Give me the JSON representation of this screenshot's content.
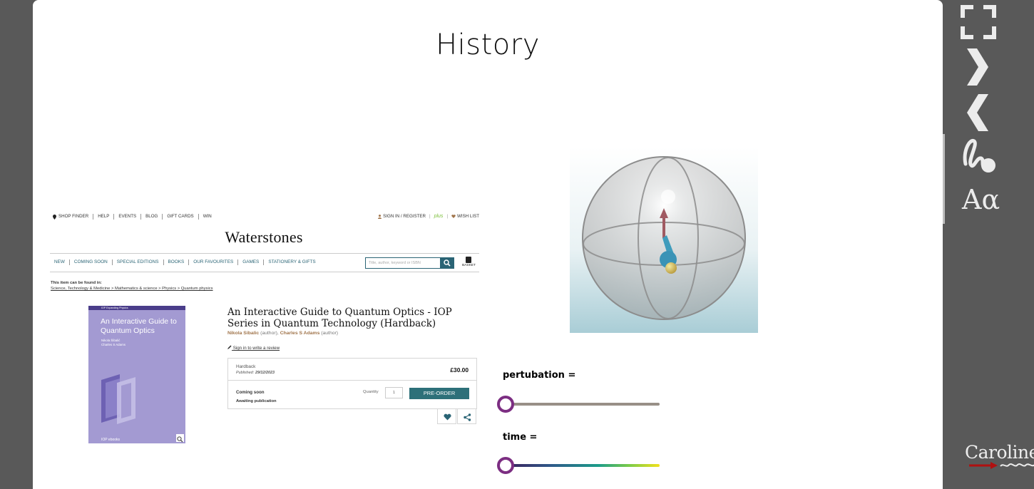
{
  "slide": {
    "title": "History"
  },
  "waterstones": {
    "top_nav": [
      "SHOP FINDER",
      "HELP",
      "EVENTS",
      "BLOG",
      "GIFT CARDS",
      "WIN"
    ],
    "sign_in": "SIGN IN / REGISTER",
    "plus": "plus",
    "wish_list": "WISH LIST",
    "logo": "Waterstones",
    "menu": [
      "NEW",
      "COMING SOON",
      "SPECIAL EDITIONS",
      "BOOKS",
      "OUR FAVOURITES",
      "GAMES",
      "STATIONERY & GIFTS"
    ],
    "search_placeholder": "Title, author, keyword or ISBN",
    "basket": "BASKET",
    "found_in_label": "This item can be found in:",
    "breadcrumb": "Science, Technology & Medicine > Mathematics & science > Physics > Quantum physics",
    "cover": {
      "series": "IOP Expanding Physics",
      "title": "An Interactive Guide to Quantum Optics",
      "authors_line1": "Nikola Šibalić",
      "authors_line2": "Charles S Adams",
      "publisher": "IOP ebooks"
    },
    "book_title": "An Interactive Guide to Quantum Optics - IOP Series in Quantum Technology (Hardback)",
    "author1": "Nikola Sibalic",
    "author2": "Charles S Adams",
    "author_role": "(author)",
    "review_link": "Sign in to write a review",
    "format": "Hardback",
    "published_label": "Published:",
    "published_date": "29/12/2023",
    "price": "£30.00",
    "status": "Coming soon",
    "availability": "Awaiting publication",
    "quantity_label": "Quantity",
    "quantity_value": "1",
    "preorder": "PRE-ORDER"
  },
  "sliders": {
    "perturbation": {
      "label": "pertubation =",
      "value": 0.0
    },
    "time": {
      "label": "time =",
      "value": 0.0
    }
  },
  "sidebar": {
    "brand": "Caroline"
  },
  "colors": {
    "waterstones_teal": "#2a6475",
    "knob_purple": "#7c2e82",
    "cover_lilac": "#a39ad2",
    "author_brown": "#a0744a"
  },
  "icons": [
    "fullscreen-icon",
    "next-icon",
    "previous-icon",
    "pen-icon",
    "font-size-icon",
    "search-icon",
    "heart-icon",
    "share-icon",
    "map-pin-icon",
    "user-icon",
    "basket-icon",
    "zoom-icon",
    "pencil-icon"
  ]
}
